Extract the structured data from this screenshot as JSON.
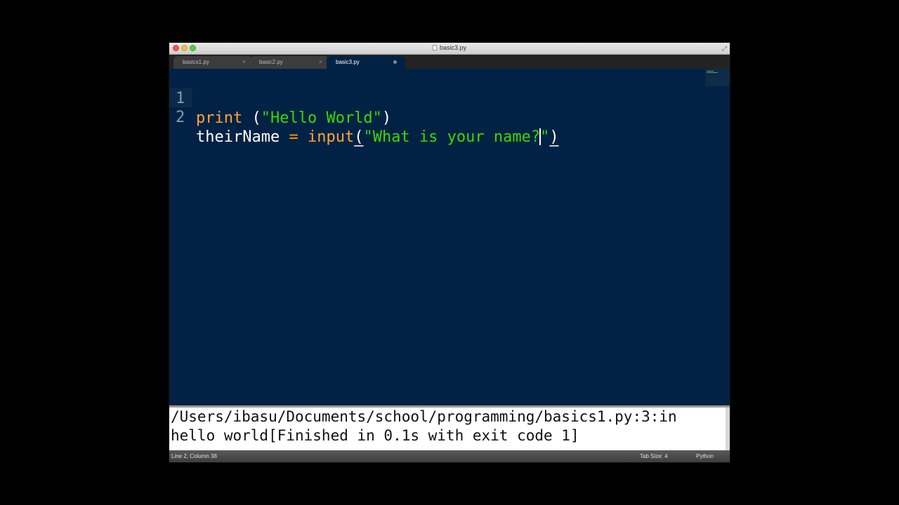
{
  "window": {
    "title": "basic3.py"
  },
  "tabs": [
    {
      "label": "basics1.py",
      "close": "×"
    },
    {
      "label": "basic2.py",
      "close": "×"
    },
    {
      "label": "basic3.py",
      "active": true
    }
  ],
  "editor": {
    "lines": [
      {
        "number": "1",
        "tokens": {
          "kw": "print",
          "sp": " ",
          "open": "(",
          "str": "\"Hello World\"",
          "close": ")"
        }
      },
      {
        "number": "2",
        "tokens": {
          "ident": "theirName",
          "sp1": " ",
          "eq": "=",
          "sp2": " ",
          "func": "input",
          "open": "(",
          "str_a": "\"What is your name?",
          "str_b": "\"",
          "close": ")"
        }
      }
    ]
  },
  "console": {
    "lines": [
      "/Users/ibasu/Documents/school/programming/basics1.py:3:in",
      "hello world[Finished in 0.1s with exit code 1]"
    ]
  },
  "statusbar": {
    "position": "Line 2, Column 38",
    "tab_size": "Tab Size: 4",
    "syntax": "Python"
  },
  "colors": {
    "editor_bg": "#012244",
    "keyword": "#ffa33b",
    "string": "#3ad900"
  },
  "icons": [
    "close-icon",
    "minimize-icon",
    "maximize-icon",
    "document-icon",
    "fullscreen-icon",
    "tab-close-icon",
    "unsaved-dot-icon"
  ]
}
